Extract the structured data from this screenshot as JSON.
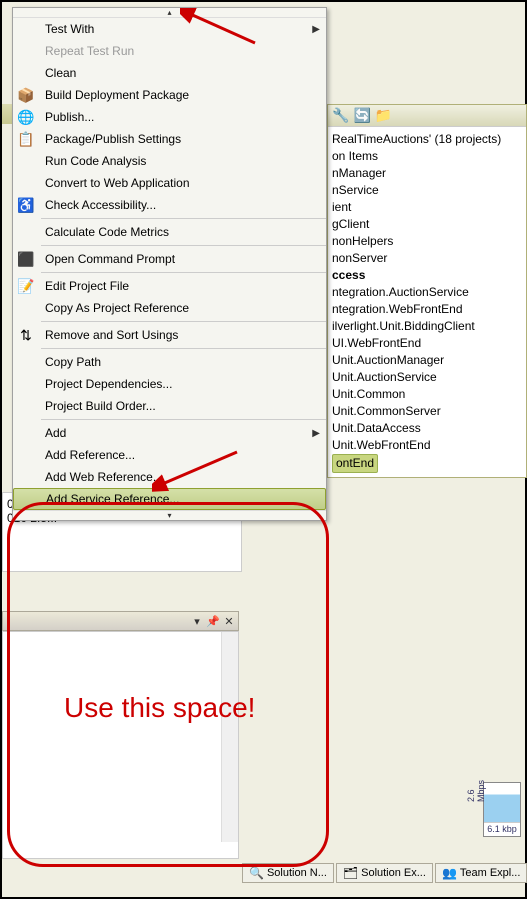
{
  "menu": {
    "items": [
      {
        "label": "Test With",
        "hasSubmenu": true,
        "icon": ""
      },
      {
        "label": "Repeat Test Run",
        "disabled": true,
        "icon": ""
      },
      {
        "label": "Clean",
        "icon": ""
      },
      {
        "label": "Build Deployment Package",
        "icon": "📦"
      },
      {
        "label": "Publish...",
        "icon": "🌐"
      },
      {
        "label": "Package/Publish Settings",
        "icon": "📋"
      },
      {
        "label": "Run Code Analysis",
        "icon": ""
      },
      {
        "label": "Convert to Web Application",
        "icon": ""
      },
      {
        "label": "Check Accessibility...",
        "icon": "♿"
      },
      {
        "label": "Calculate Code Metrics",
        "icon": ""
      },
      {
        "label": "Open Command Prompt",
        "icon": "⬛"
      },
      {
        "label": "Edit Project File",
        "icon": "📝"
      },
      {
        "label": "Copy As Project Reference",
        "icon": ""
      },
      {
        "label": "Remove and Sort Usings",
        "icon": "⇅"
      },
      {
        "label": "Copy Path",
        "icon": ""
      },
      {
        "label": "Project Dependencies...",
        "icon": ""
      },
      {
        "label": "Project Build Order...",
        "icon": ""
      },
      {
        "label": "Add",
        "hasSubmenu": true,
        "icon": ""
      },
      {
        "label": "Add Reference...",
        "icon": ""
      },
      {
        "label": "Add Web Reference...",
        "icon": ""
      },
      {
        "label": "Add Service Reference...",
        "icon": "",
        "highlighted": true
      }
    ],
    "separators": [
      8,
      9,
      10,
      12,
      13,
      14,
      17
    ]
  },
  "annotation": {
    "text": "Use this space!"
  },
  "solution_explorer": {
    "header": "RealTimeAuctions' (18 projects)",
    "items": [
      "on Items",
      "nManager",
      "nService",
      "ient",
      "gClient",
      "nonHelpers",
      "nonServer",
      "ccess",
      "ntegration.AuctionService",
      "ntegration.WebFrontEnd",
      "ilverlight.Unit.BiddingClient",
      "UI.WebFrontEnd",
      "Unit.AuctionManager",
      "Unit.AuctionService",
      "Unit.Common",
      "Unit.CommonServer",
      "Unit.DataAccess",
      "Unit.WebFrontEnd"
    ],
    "selected": "ontEnd"
  },
  "below": {
    "item1": "010 11:...",
    "item2": "010 2:5..."
  },
  "status_tabs": {
    "tab1": "Solution N...",
    "tab2": "Solution Ex...",
    "tab3": "Team Expl..."
  },
  "perf": {
    "rate": "2.6 Mbps",
    "footer": "6.1 kbp"
  }
}
